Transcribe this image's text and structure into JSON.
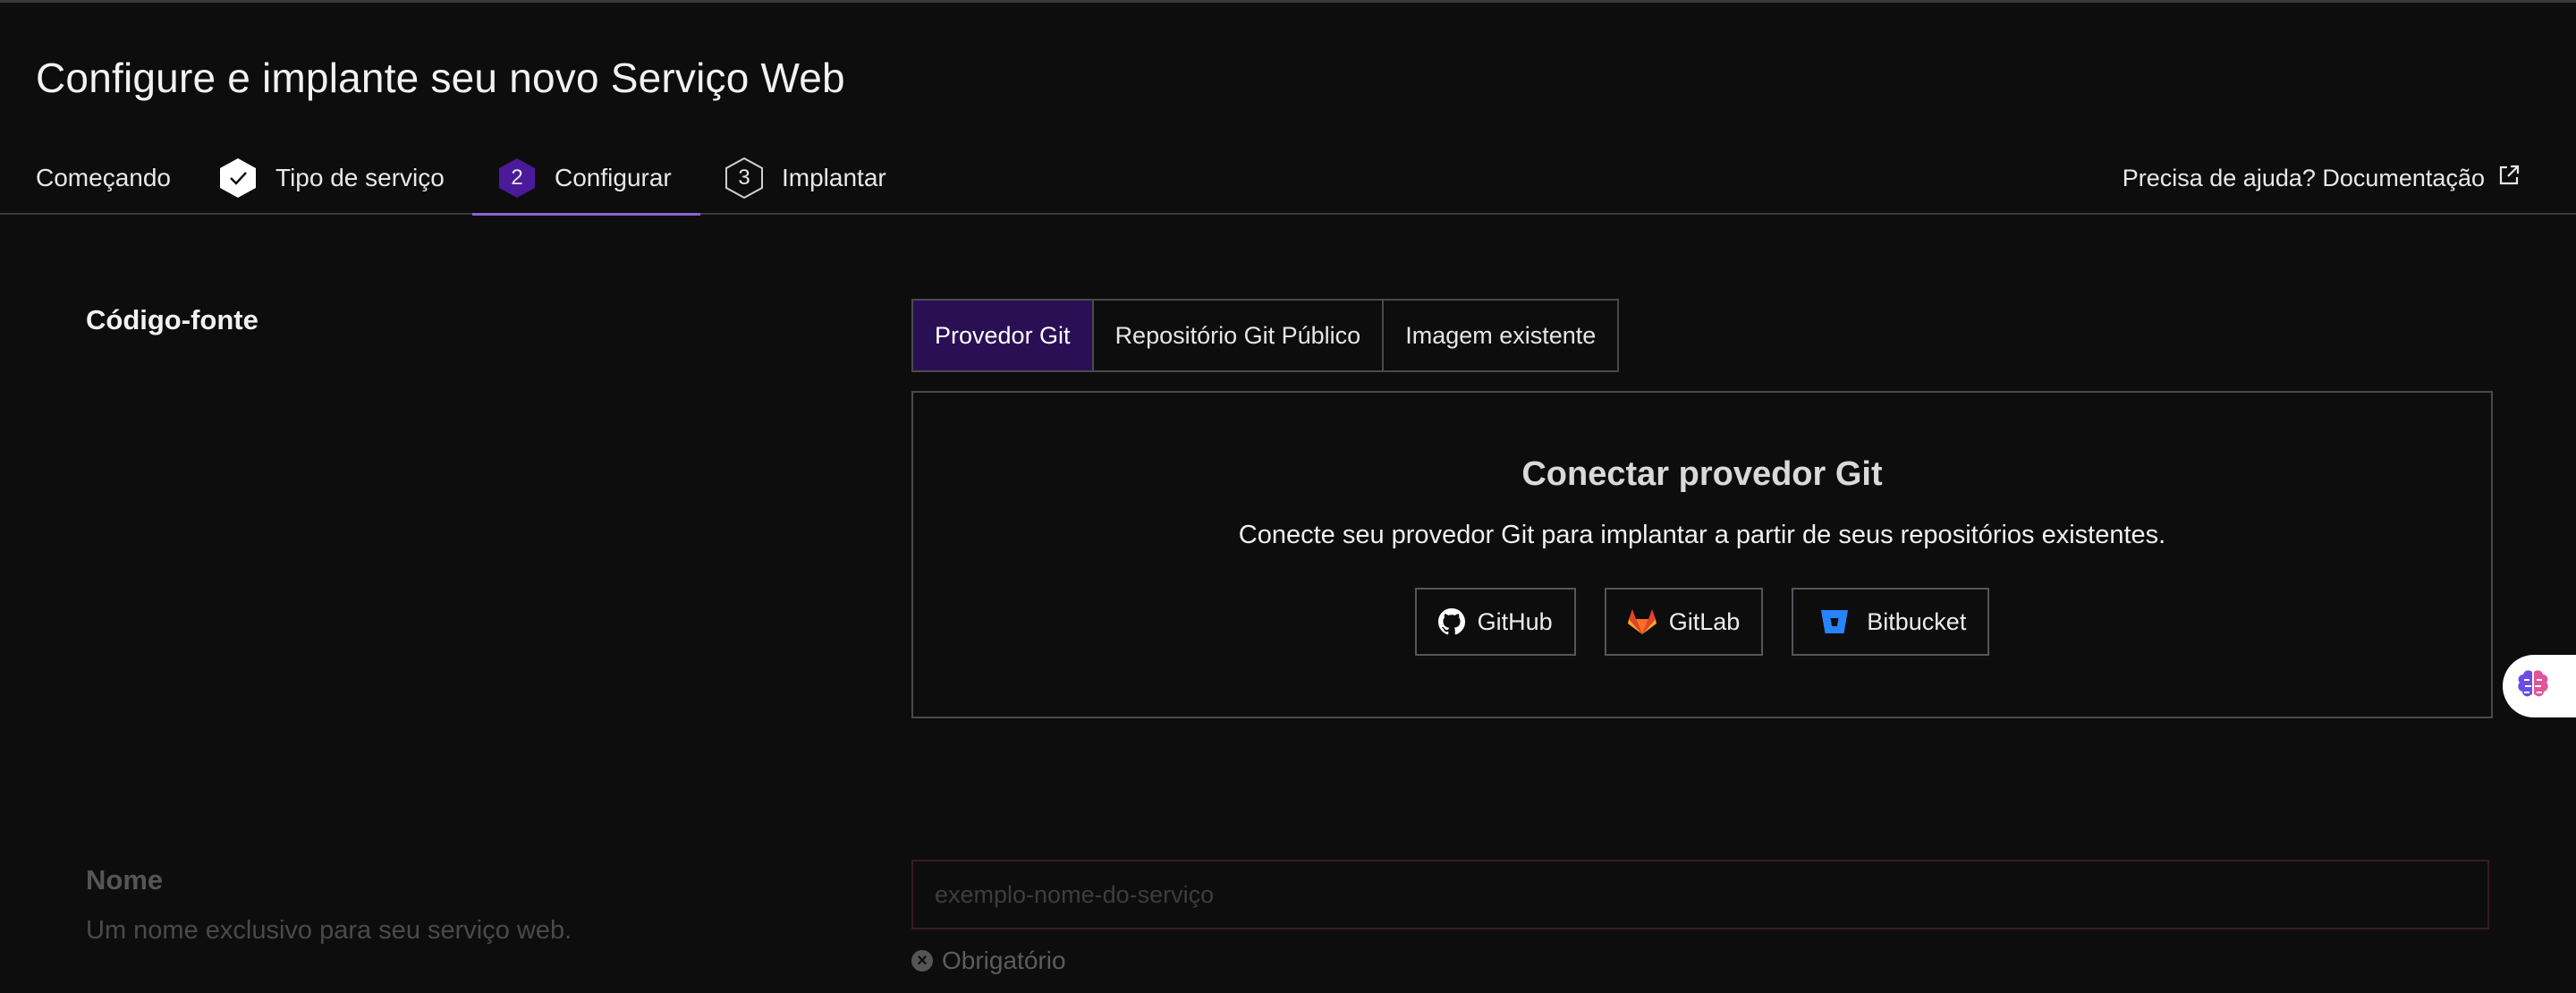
{
  "page": {
    "title": "Configure e implante seu novo Serviço Web"
  },
  "steps": [
    {
      "label": "Começando",
      "number": ""
    },
    {
      "label": "Tipo de serviço",
      "number": ""
    },
    {
      "label": "Configurar",
      "number": "2"
    },
    {
      "label": "Implantar",
      "number": "3"
    }
  ],
  "help": {
    "label": "Precisa de ajuda? Documentação",
    "icon": "external-link-icon"
  },
  "source": {
    "label": "Código-fonte",
    "tabs": [
      "Provedor Git",
      "Repositório Git Público",
      "Imagem existente"
    ],
    "selected_tab": "Provedor Git",
    "connect_title": "Conectar provedor Git",
    "connect_desc": "Conecte seu provedor Git para implantar a partir de seus repositórios existentes.",
    "providers": [
      {
        "label": "GitHub",
        "icon": "github-icon"
      },
      {
        "label": "GitLab",
        "icon": "gitlab-icon"
      },
      {
        "label": "Bitbucket",
        "icon": "bitbucket-icon"
      }
    ]
  },
  "name_field": {
    "label": "Nome",
    "description": "Um nome exclusivo para seu serviço web.",
    "placeholder": "exemplo-nome-do-serviço",
    "required_msg": "Obrigatório"
  },
  "colors": {
    "accent": "#8a63d2",
    "selected_bg": "#2a0f55",
    "background": "#0d0d0e"
  }
}
